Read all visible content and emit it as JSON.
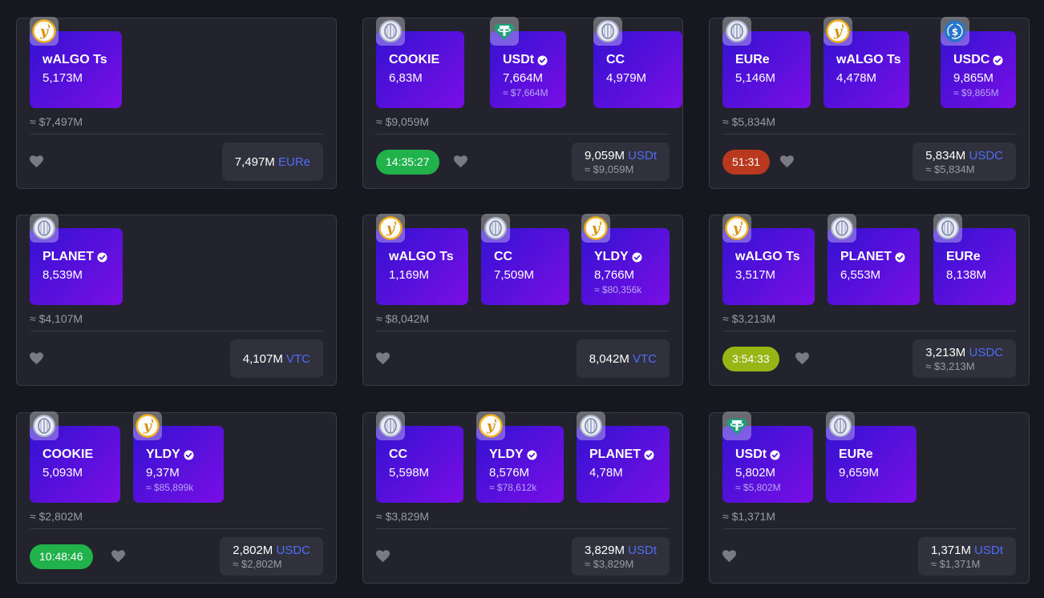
{
  "colors": {
    "background": "#17171f",
    "card": "#23232d",
    "asset_gradient_start": "#3312d2",
    "asset_gradient_end": "#7a0ee6",
    "currency_accent": "#4f6df5",
    "timer_green": "#22b24c",
    "timer_red": "#b8391e",
    "timer_lime": "#97b514"
  },
  "cards": [
    {
      "assets": [
        {
          "icon": "yldy-coin-icon",
          "name": "wALGO Ts",
          "verified": false,
          "amount": "5,173M",
          "usd": ""
        }
      ],
      "total": "≈ $7,497M",
      "timer": null,
      "price": {
        "amount": "7,497M",
        "currency": "EURe",
        "usd": ""
      }
    },
    {
      "assets": [
        {
          "icon": "coin-icon",
          "name": "COOKIE",
          "verified": false,
          "amount": "6,83M",
          "usd": ""
        },
        {
          "icon": "tether-icon",
          "name": "USDt",
          "verified": true,
          "amount": "7,664M",
          "usd": "≈ $7,664M"
        },
        {
          "icon": "coin-icon",
          "name": "CC",
          "verified": false,
          "amount": "4,979M",
          "usd": ""
        }
      ],
      "total": "≈ $9,059M",
      "timer": {
        "text": "14:35:27",
        "color": "#22b24c"
      },
      "price": {
        "amount": "9,059M",
        "currency": "USDt",
        "usd": "≈ $9,059M"
      }
    },
    {
      "assets": [
        {
          "icon": "coin-icon",
          "name": "EURe",
          "verified": false,
          "amount": "5,146M",
          "usd": ""
        },
        {
          "icon": "yldy-coin-icon",
          "name": "wALGO Ts",
          "verified": false,
          "amount": "4,478M",
          "usd": ""
        },
        {
          "icon": "usdc-icon",
          "name": "USDC",
          "verified": true,
          "amount": "9,865M",
          "usd": "≈ $9,865M"
        }
      ],
      "total": "≈ $5,834M",
      "timer": {
        "text": "51:31",
        "color": "#b8391e"
      },
      "price": {
        "amount": "5,834M",
        "currency": "USDC",
        "usd": "≈ $5,834M"
      }
    },
    {
      "assets": [
        {
          "icon": "coin-icon",
          "name": "PLANET",
          "verified": true,
          "amount": "8,539M",
          "usd": ""
        }
      ],
      "total": "≈ $4,107M",
      "timer": null,
      "price": {
        "amount": "4,107M",
        "currency": "VTC",
        "usd": ""
      }
    },
    {
      "assets": [
        {
          "icon": "yldy-coin-icon",
          "name": "wALGO Ts",
          "verified": false,
          "amount": "1,169M",
          "usd": ""
        },
        {
          "icon": "coin-icon",
          "name": "CC",
          "verified": false,
          "amount": "7,509M",
          "usd": ""
        },
        {
          "icon": "yldy-coin-icon",
          "name": "YLDY",
          "verified": true,
          "amount": "8,766M",
          "usd": "≈ $80,356k"
        }
      ],
      "total": "≈ $8,042M",
      "timer": null,
      "price": {
        "amount": "8,042M",
        "currency": "VTC",
        "usd": ""
      }
    },
    {
      "assets": [
        {
          "icon": "yldy-coin-icon",
          "name": "wALGO Ts",
          "verified": false,
          "amount": "3,517M",
          "usd": ""
        },
        {
          "icon": "coin-icon",
          "name": "PLANET",
          "verified": true,
          "amount": "6,553M",
          "usd": ""
        },
        {
          "icon": "coin-icon",
          "name": "EURe",
          "verified": false,
          "amount": "8,138M",
          "usd": ""
        }
      ],
      "total": "≈ $3,213M",
      "timer": {
        "text": "3:54:33",
        "color": "#97b514"
      },
      "price": {
        "amount": "3,213M",
        "currency": "USDC",
        "usd": "≈ $3,213M"
      }
    },
    {
      "assets": [
        {
          "icon": "coin-icon",
          "name": "COOKIE",
          "verified": false,
          "amount": "5,093M",
          "usd": ""
        },
        {
          "icon": "yldy-coin-icon",
          "name": "YLDY",
          "verified": true,
          "amount": "9,37M",
          "usd": "≈ $85,899k"
        }
      ],
      "total": "≈ $2,802M",
      "timer": {
        "text": "10:48:46",
        "color": "#22b24c"
      },
      "price": {
        "amount": "2,802M",
        "currency": "USDC",
        "usd": "≈ $2,802M"
      }
    },
    {
      "assets": [
        {
          "icon": "coin-icon",
          "name": "CC",
          "verified": false,
          "amount": "5,598M",
          "usd": ""
        },
        {
          "icon": "yldy-coin-icon",
          "name": "YLDY",
          "verified": true,
          "amount": "8,576M",
          "usd": "≈ $78,612k"
        },
        {
          "icon": "coin-icon",
          "name": "PLANET",
          "verified": true,
          "amount": "4,78M",
          "usd": ""
        }
      ],
      "total": "≈ $3,829M",
      "timer": null,
      "price": {
        "amount": "3,829M",
        "currency": "USDt",
        "usd": "≈ $3,829M"
      }
    },
    {
      "assets": [
        {
          "icon": "tether-icon",
          "name": "USDt",
          "verified": true,
          "amount": "5,802M",
          "usd": "≈ $5,802M"
        },
        {
          "icon": "coin-icon",
          "name": "EURe",
          "verified": false,
          "amount": "9,659M",
          "usd": ""
        }
      ],
      "total": "≈ $1,371M",
      "timer": null,
      "price": {
        "amount": "1,371M",
        "currency": "USDt",
        "usd": "≈ $1,371M"
      }
    }
  ]
}
